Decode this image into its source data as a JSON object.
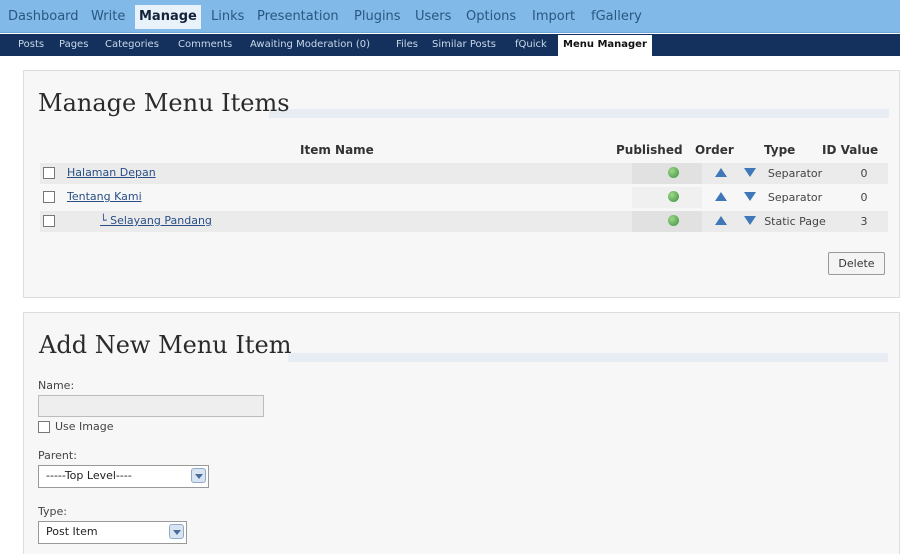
{
  "top_nav": {
    "items": [
      {
        "label": "Dashboard"
      },
      {
        "label": "Write"
      },
      {
        "label": "Manage"
      },
      {
        "label": "Links"
      },
      {
        "label": "Presentation"
      },
      {
        "label": "Plugins"
      },
      {
        "label": "Users"
      },
      {
        "label": "Options"
      },
      {
        "label": "Import"
      },
      {
        "label": "fGallery"
      }
    ],
    "active": "Manage"
  },
  "sub_nav": {
    "items": [
      {
        "label": "Posts"
      },
      {
        "label": "Pages"
      },
      {
        "label": "Categories"
      },
      {
        "label": "Comments"
      },
      {
        "label": "Awaiting Moderation (0)"
      },
      {
        "label": "Files"
      },
      {
        "label": "Similar Posts"
      },
      {
        "label": "fQuick"
      },
      {
        "label": "Menu Manager"
      }
    ],
    "active": "Menu Manager"
  },
  "manage": {
    "title": "Manage Menu Items",
    "columns": {
      "item_name": "Item Name",
      "published": "Published",
      "order": "Order",
      "type": "Type",
      "id_value": "ID Value"
    },
    "rows": [
      {
        "name": "Halaman Depan",
        "type": "Separator",
        "id": "0"
      },
      {
        "name": "Tentang Kami",
        "type": "Separator",
        "id": "0"
      },
      {
        "name": "└ Selayang Pandang",
        "type": "Static Page",
        "id": "3"
      }
    ],
    "delete_label": "Delete"
  },
  "add": {
    "title": "Add New Menu Item",
    "name_label": "Name:",
    "name_value": "",
    "use_image_label": "Use Image",
    "parent_label": "Parent:",
    "parent_value": "-----Top Level----",
    "type_label": "Type:",
    "type_value": "Post Item"
  },
  "colors": {
    "top_nav_bg": "#81b9e8",
    "sub_nav_bg": "#13315c",
    "link": "#2a4f86",
    "arrow_icon": "#3f77b8",
    "published_icon": "#3c8e3a"
  },
  "icons": {
    "published": "published-icon",
    "order_up": "arrow-up-icon",
    "order_down": "arrow-down-icon",
    "select_toggle": "chevron-down-icon"
  }
}
